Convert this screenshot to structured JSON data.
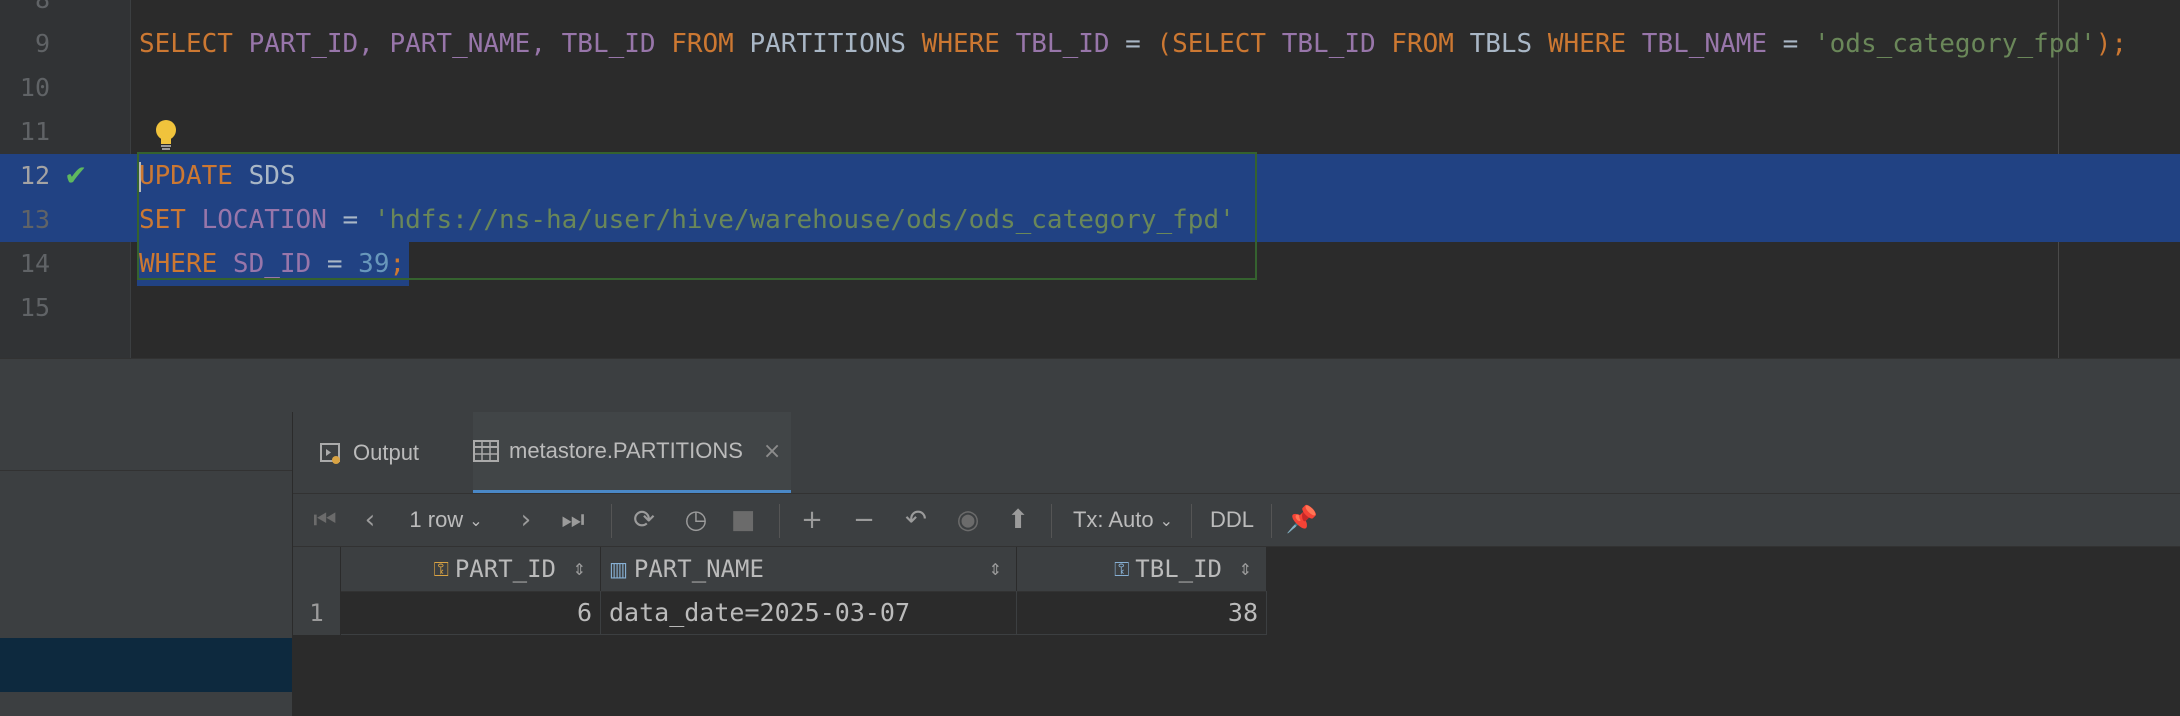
{
  "editor": {
    "lines": [
      {
        "num": "8"
      },
      {
        "num": "9"
      },
      {
        "num": "10"
      },
      {
        "num": "11"
      },
      {
        "num": "12"
      },
      {
        "num": "13"
      },
      {
        "num": "14"
      },
      {
        "num": "15"
      }
    ],
    "line9": {
      "t1": "SELECT",
      "t2": " PART_ID, PART_NAME, TBL_ID",
      "t3": " FROM",
      "t4": " PARTITIONS",
      "t5": " WHERE",
      "t6": " TBL_ID",
      "t7": " = ",
      "t8": "(",
      "t9": "SELECT",
      "t10": " TBL_ID",
      "t11": " FROM",
      "t12": " TBLS",
      "t13": " WHERE",
      "t14": " TBL_NAME",
      "t15": " = ",
      "t16": "'ods_category_fpd'",
      "t17": ");"
    },
    "line12": {
      "t1": "UPDATE",
      "t2": " SDS"
    },
    "line13": {
      "t1": "SET",
      "t2": " LOCATION",
      "t3": " = ",
      "t4": "'hdfs://ns-ha/user/hive/warehouse/ods/ods_category_fpd'"
    },
    "line14": {
      "t1": "WHERE",
      "t2": " SD_ID",
      "t3": " = ",
      "t4": "39",
      "t5": ";"
    }
  },
  "colors": {
    "keyword": "#cc7832",
    "identifier": "#9876aa",
    "string": "#6a8759",
    "number": "#6897bb",
    "selection": "#214283",
    "check": "#5eb85e"
  },
  "tabs": [
    {
      "label": "Output",
      "icon": "output-console-icon"
    },
    {
      "label": "metastore.PARTITIONS",
      "icon": "table-grid-icon",
      "close": "×"
    }
  ],
  "toolbar": {
    "row_count": "1 row",
    "tx_mode": "Tx: Auto",
    "ddl": "DDL"
  },
  "grid": {
    "columns": [
      "PART_ID",
      "PART_NAME",
      "TBL_ID"
    ],
    "rows": [
      {
        "index": "1",
        "PART_ID": "6",
        "PART_NAME": "data_date=2025-03-07",
        "TBL_ID": "38"
      }
    ]
  }
}
